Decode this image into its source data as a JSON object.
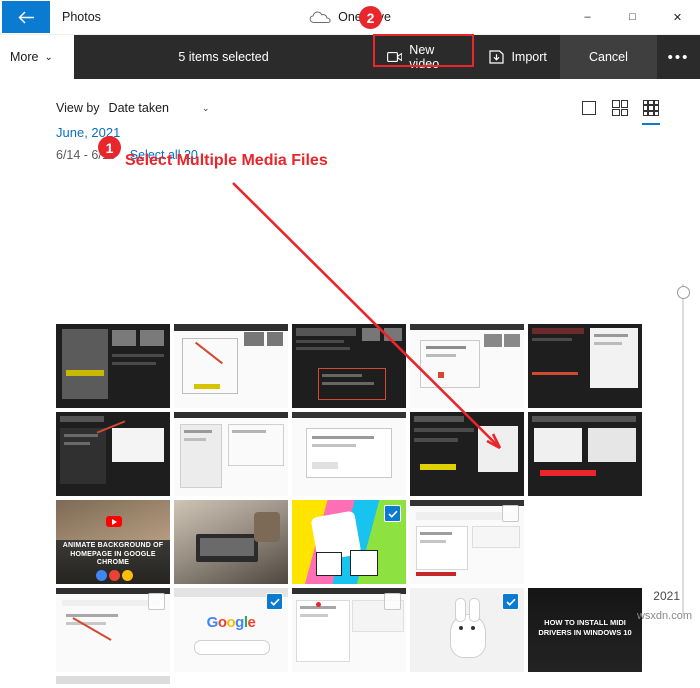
{
  "window": {
    "app_title": "Photos",
    "center_label": "OneDrive",
    "back_icon": "back-arrow-icon",
    "cloud_icon": "cloud-icon",
    "minimize": "–",
    "maximize": "□",
    "close": "✕"
  },
  "command_bar": {
    "more_label": "More",
    "more_chevron": "⌄",
    "selection_text": "5 items selected",
    "new_video_label": "New video",
    "new_video_icon": "video-camera-icon",
    "import_label": "Import",
    "import_icon": "import-icon",
    "cancel_label": "Cancel",
    "overflow_label": "•••"
  },
  "toolbar": {
    "view_by_label": "View by",
    "view_by_value": "Date taken",
    "view_by_chevron": "⌄",
    "layout_icons": [
      "single-photo-layout-icon",
      "medium-grid-layout-icon",
      "small-grid-layout-icon"
    ],
    "active_layout_index": 2
  },
  "group": {
    "month_label": "June, 2021",
    "date_range": "6/14 - 6/15",
    "select_all_label": "Select all 20"
  },
  "annotations": {
    "badge_one": "1",
    "badge_two": "2",
    "callout_text": "Select Multiple Media Files",
    "accent_color": "#e8262b"
  },
  "scroll": {
    "year_label": "2021"
  },
  "watermark": "wsxdn.com",
  "colors": {
    "accent": "#0a7bd1",
    "command_bar_bg": "#2b2b2b",
    "cancel_bg": "#3f3f3f",
    "link": "#0a6fc2"
  },
  "grid": {
    "rows": [
      [
        {
          "name": "thumb-screenshot-dark-1",
          "selected": false,
          "kind": "dark"
        },
        {
          "name": "thumb-screenshot-light-1",
          "selected": false,
          "kind": "light"
        },
        {
          "name": "thumb-screenshot-dark-2",
          "selected": false,
          "kind": "dark"
        },
        {
          "name": "thumb-screenshot-light-2",
          "selected": false,
          "kind": "light"
        },
        {
          "name": "thumb-screenshot-dark-3",
          "selected": false,
          "kind": "dark"
        }
      ],
      [
        {
          "name": "thumb-screenshot-dark-4",
          "selected": false,
          "kind": "dark"
        },
        {
          "name": "thumb-screenshot-light-3",
          "selected": false,
          "kind": "light"
        },
        {
          "name": "thumb-screenshot-light-4",
          "selected": false,
          "kind": "light"
        },
        {
          "name": "thumb-screenshot-dark-5",
          "selected": false,
          "kind": "dark"
        },
        {
          "name": "thumb-screenshot-dark-6",
          "selected": false,
          "kind": "dark"
        }
      ],
      [
        {
          "name": "thumb-photo-animate-background",
          "selected": false,
          "kind": "photo",
          "caption": "ANIMATE BACKGROUND OF HOMEPAGE IN GOOGLE CHROME"
        },
        {
          "name": "thumb-photo-laptop-desk",
          "selected": false,
          "kind": "photo"
        },
        {
          "name": "thumb-photo-rainbow-doodle",
          "selected": true,
          "kind": "colorful"
        },
        {
          "name": "thumb-screenshot-light-5",
          "selected": false,
          "kind": "light-unchecked"
        }
      ],
      [
        {
          "name": "thumb-screenshot-light-6",
          "selected": false,
          "kind": "light-unchecked"
        },
        {
          "name": "thumb-screenshot-google",
          "selected": true,
          "kind": "google"
        },
        {
          "name": "thumb-screenshot-light-7",
          "selected": false,
          "kind": "light"
        },
        {
          "name": "thumb-photo-rabbit",
          "selected": true,
          "kind": "rabbit"
        },
        {
          "name": "thumb-photo-midi-drivers",
          "selected": false,
          "kind": "dark-text",
          "caption": "HOW TO INSTALL MIDI DRIVERS IN WINDOWS 10"
        }
      ]
    ]
  }
}
